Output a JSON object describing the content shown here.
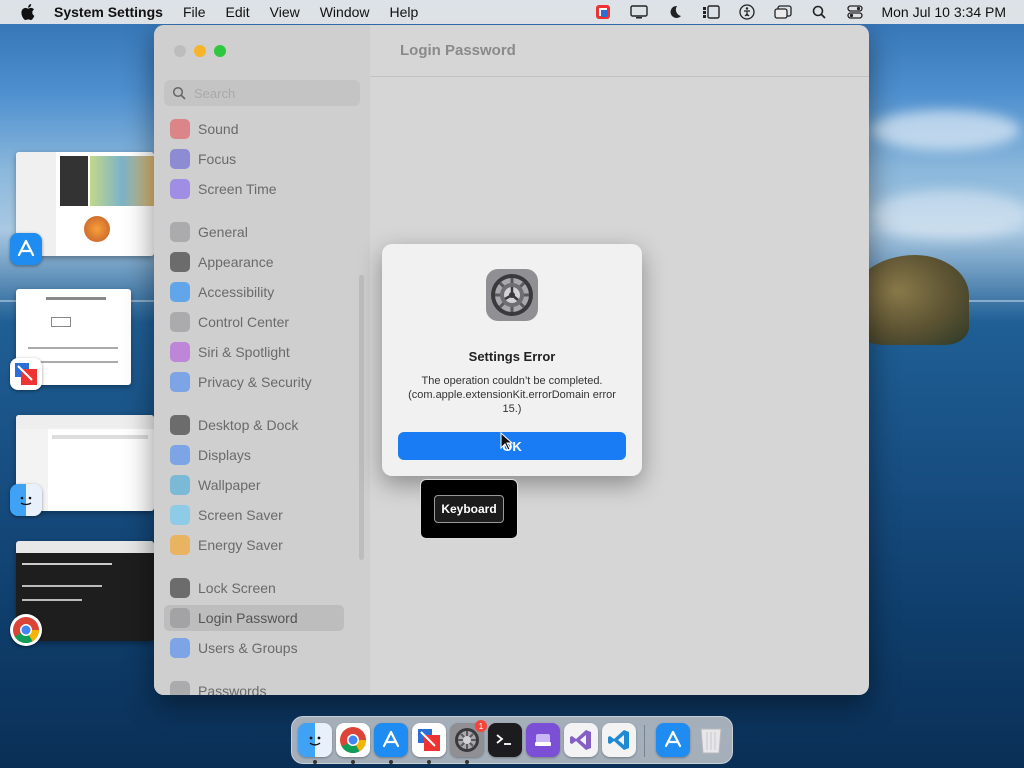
{
  "menubar": {
    "app_name": "System Settings",
    "menus": [
      "File",
      "Edit",
      "View",
      "Window",
      "Help"
    ],
    "clock": "Mon Jul 10  3:34 PM",
    "status_icons": [
      "parallels-icon",
      "display-icon",
      "focus-moon-icon",
      "stage-manager-icon",
      "accessibility-icon",
      "window-icon",
      "search-icon",
      "control-center-icon"
    ]
  },
  "window": {
    "title": "Login Password",
    "search_placeholder": "Search",
    "sidebar": [
      {
        "label": "Sound",
        "icon": "sound-icon",
        "color": "#e7484e"
      },
      {
        "label": "Focus",
        "icon": "focus-moon-icon",
        "color": "#5856d6"
      },
      {
        "label": "Screen Time",
        "icon": "hourglass-icon",
        "color": "#7a5af5"
      },
      {
        "label": "General",
        "icon": "gear-icon",
        "color": "#8e8e93"
      },
      {
        "label": "Appearance",
        "icon": "appearance-icon",
        "color": "#1c1c1e"
      },
      {
        "label": "Accessibility",
        "icon": "accessibility-icon",
        "color": "#0a84ff"
      },
      {
        "label": "Control Center",
        "icon": "control-center-icon",
        "color": "#8e8e93"
      },
      {
        "label": "Siri & Spotlight",
        "icon": "siri-icon",
        "color": "#b04be0"
      },
      {
        "label": "Privacy & Security",
        "icon": "hand-icon",
        "color": "#3a82f7"
      },
      {
        "label": "Desktop & Dock",
        "icon": "dock-icon",
        "color": "#1c1c1e"
      },
      {
        "label": "Displays",
        "icon": "sun-icon",
        "color": "#3a82f7"
      },
      {
        "label": "Wallpaper",
        "icon": "wallpaper-icon",
        "color": "#34aadc"
      },
      {
        "label": "Screen Saver",
        "icon": "screen-saver-icon",
        "color": "#5ac8fa"
      },
      {
        "label": "Energy Saver",
        "icon": "battery-icon",
        "color": "#ff9f0a"
      },
      {
        "label": "Lock Screen",
        "icon": "lock-icon",
        "color": "#1c1c1e"
      },
      {
        "label": "Login Password",
        "icon": "lock-icon",
        "color": "#8e8e93"
      },
      {
        "label": "Users & Groups",
        "icon": "users-icon",
        "color": "#3a82f7"
      },
      {
        "label": "Passwords",
        "icon": "key-icon",
        "color": "#8e8e93"
      }
    ],
    "active_item": "Login Password"
  },
  "dialog": {
    "title": "Settings Error",
    "message": "The operation couldn’t be completed. (com.apple.extensionKit.errorDomain error 15.)",
    "ok_label": "OK"
  },
  "keyboard_popup": {
    "label": "Keyboard"
  },
  "dock": {
    "apps": [
      "finder-icon",
      "chrome-icon",
      "app-store-icon",
      "parallels-icon",
      "system-settings-icon",
      "terminal-icon",
      "stack-icon",
      "visual-studio-icon",
      "vscode-icon",
      "app-store-icon",
      "trash-icon"
    ],
    "settings_badge": "1"
  }
}
